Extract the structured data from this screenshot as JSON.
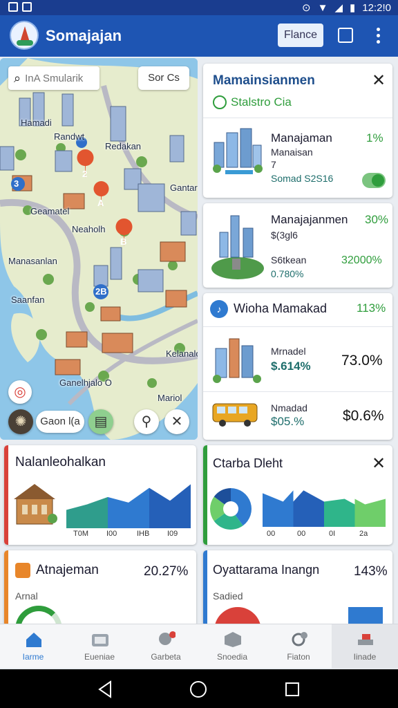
{
  "status_bar": {
    "time": "12:2!0"
  },
  "app_bar": {
    "title": "Somajajan",
    "finance_button": "Flance"
  },
  "map": {
    "search_placeholder": "InA Smularik",
    "sort_chip": "Sor Cs",
    "labels": [
      "Hamadi",
      "Randwt",
      "Redakan",
      "Gantar",
      "Geamatel",
      "Neaholh",
      "Manasanlan",
      "Saanfan",
      "Kelanalo",
      "Ganelhjalo O",
      "Mariol"
    ],
    "pins": [
      "3",
      "2",
      "A",
      "B",
      "2B"
    ],
    "bottom_chip": "Gaon l(a",
    "colors": {
      "water": "#8ec6e8",
      "land": "#e6eccd",
      "road": "#b9b9c4"
    }
  },
  "info_panel": {
    "title": "Mamainsianmen",
    "subtitle": "Stalstro Cia",
    "items": [
      {
        "title": "Manajaman",
        "sub1": "Manaisan",
        "sub2": "7",
        "sub3": "Somad S2S16",
        "value": "1%"
      },
      {
        "title": "Manajajanmen",
        "sub1": "$(3gl6",
        "sub2": "S6tkean",
        "sub3": "0.780%",
        "value": "30%",
        "value2": "32000%"
      }
    ]
  },
  "stats_panel": {
    "title": "Wioha Mamakad",
    "value": "113%",
    "items": [
      {
        "label": "Mrnadel",
        "amount": "$.614%",
        "value": "73.0%"
      },
      {
        "label": "Nmadad",
        "amount": "$05.%",
        "value": "$0.6%"
      }
    ]
  },
  "charts": [
    {
      "title": "Nalanleohalkan",
      "chart_data": {
        "type": "area",
        "categories": [
          "T0M",
          "I00",
          "IHB",
          "I09"
        ],
        "values": [
          20,
          26,
          34,
          28,
          44,
          30,
          48
        ],
        "title": "Nalanleohalkan"
      }
    },
    {
      "title": "Ctarba Dleht",
      "chart_data": {
        "type": "area",
        "categories": [
          "00",
          "00",
          "0I",
          "2a"
        ],
        "values": [
          24,
          18,
          26,
          18,
          20,
          16,
          20
        ],
        "pie": [
          40,
          25,
          20,
          15
        ],
        "title": "Ctarba Dleht"
      }
    },
    {
      "title": "Atnajeman",
      "value": "20.27%",
      "sub": "Arnal"
    },
    {
      "title": "Oyattarama Inangn",
      "value": "143%",
      "sub": "Sadied"
    }
  ],
  "bottom_nav": [
    {
      "label": "Iarme",
      "icon": "home-icon"
    },
    {
      "label": "Eueniae",
      "icon": "camera-icon"
    },
    {
      "label": "Garbeta",
      "icon": "search-icon"
    },
    {
      "label": "Snoedia",
      "icon": "box-icon"
    },
    {
      "label": "Fiaton",
      "icon": "lens-icon"
    },
    {
      "label": "Iinade",
      "icon": "trade-icon"
    }
  ],
  "accent_colors": {
    "brand": "#1e55b3",
    "green": "#2f9d3c",
    "red": "#d9413a",
    "orange": "#e8862a",
    "blue": "#2f7ad0"
  }
}
